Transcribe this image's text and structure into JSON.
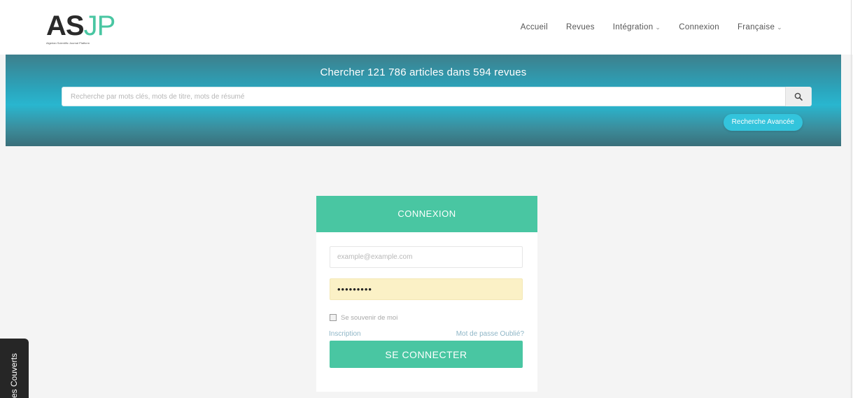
{
  "brand": {
    "logo_dark": "AS",
    "logo_accent": "JP",
    "tagline": "Algerian Scientific Journal Platform",
    "accent_color": "#49c6a2"
  },
  "nav": {
    "items": [
      {
        "label": "Accueil",
        "dropdown": false
      },
      {
        "label": "Revues",
        "dropdown": false
      },
      {
        "label": "Intégration",
        "dropdown": true
      },
      {
        "label": "Connexion",
        "dropdown": false
      },
      {
        "label": "Française",
        "dropdown": true
      }
    ],
    "chevron_icon": "chevron-down-icon"
  },
  "hero": {
    "title": "Chercher 121 786 articles dans 594 revues",
    "search_placeholder": "Recherche par mots clés, mots de titre, mots de résumé",
    "search_icon": "search-icon",
    "advanced_label": "Recherche Avancée"
  },
  "login": {
    "title": "CONNEXION",
    "email_placeholder": "example@example.com",
    "password_value": "•••••••••",
    "remember_label": "Se souvenir de moi",
    "signup_link": "Inscription",
    "forgot_link": "Mot de passe Oublié?",
    "submit_label": "SE CONNECTER"
  },
  "side_tab": {
    "label": "es Couverts"
  },
  "colors": {
    "hero_teal": "#29b6cf",
    "advanced_button": "#33c4dc",
    "password_autofill": "#fbf1c6"
  }
}
